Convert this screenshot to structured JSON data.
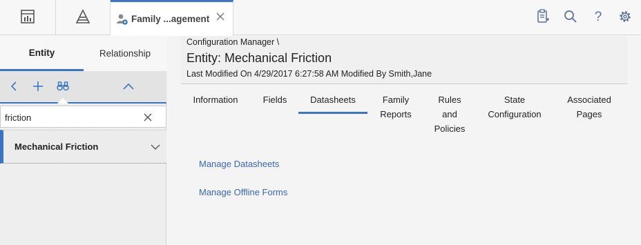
{
  "topbar": {
    "tab_label": "Family ...agement",
    "icons": [
      "dashboard-icon",
      "asset-hierarchy-icon",
      "family-management-icon",
      "close-icon",
      "clipboard-add-icon",
      "search-icon",
      "help-icon",
      "settings-icon"
    ]
  },
  "left_panel": {
    "tabs": {
      "entity": "Entity",
      "relationship": "Relationship"
    },
    "search": {
      "value": "friction"
    },
    "results": [
      {
        "label": "Mechanical Friction"
      }
    ]
  },
  "main": {
    "breadcrumb": "Configuration Manager \\",
    "title": "Entity: Mechanical Friction",
    "modified": "Last Modified On 4/29/2017 6:27:58 AM Modified By Smith,Jane",
    "tabs": [
      {
        "line1": "Information",
        "line2": "",
        "line3": ""
      },
      {
        "line1": "Fields",
        "line2": "",
        "line3": ""
      },
      {
        "line1": "Datasheets",
        "line2": "",
        "line3": ""
      },
      {
        "line1": "Family",
        "line2": "Reports",
        "line3": ""
      },
      {
        "line1": "Rules",
        "line2": "and",
        "line3": "Policies"
      },
      {
        "line1": "State",
        "line2": "Configuration",
        "line3": ""
      },
      {
        "line1": "Associated",
        "line2": "Pages",
        "line3": ""
      }
    ],
    "active_tab": "Datasheets",
    "links": {
      "manage_datasheets": "Manage Datasheets",
      "manage_offline_forms": "Manage Offline Forms"
    }
  },
  "colors": {
    "accent": "#3a75c4",
    "link": "#3a66b5",
    "icon": "#5a6f9a"
  }
}
